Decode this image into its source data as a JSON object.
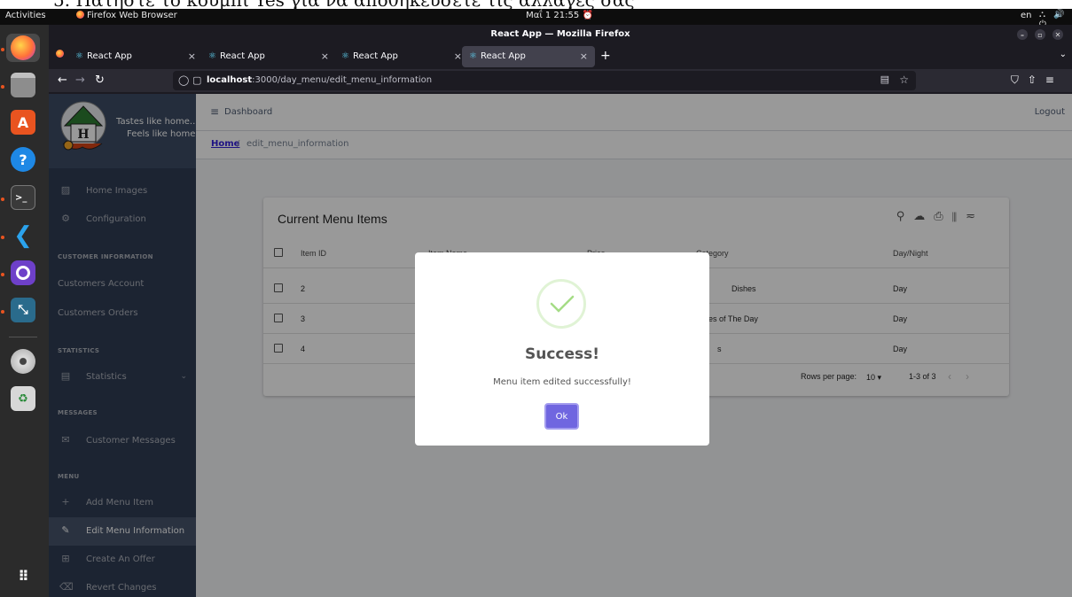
{
  "os": {
    "activities": "Activities",
    "app_name": "Firefox Web Browser",
    "clock": "Μαΐ 1 21:55",
    "lang": "en",
    "system_icons": "⛬ 🔊 ⏻"
  },
  "window": {
    "title": "React App — Mozilla Firefox"
  },
  "tabs": [
    {
      "label": "React App",
      "active": false
    },
    {
      "label": "React App",
      "active": false
    },
    {
      "label": "React App",
      "active": false
    },
    {
      "label": "React App",
      "active": true
    }
  ],
  "address": {
    "host": "localhost",
    "path": ":3000/day_menu/edit_menu_information"
  },
  "brand": {
    "tagline_1": "Tastes like home...",
    "tagline_2": "Feels like home"
  },
  "sidebar": {
    "items": [
      {
        "label": "Home Images",
        "icon": "image-icon"
      },
      {
        "label": "Configuration",
        "icon": "gear-icon"
      }
    ],
    "sections": [
      {
        "title": "CUSTOMER INFORMATION",
        "items": [
          "Customers Account",
          "Customers Orders"
        ]
      },
      {
        "title": "STATISTICS",
        "items": [
          "Statistics"
        ]
      },
      {
        "title": "MESSAGES",
        "items": [
          "Customer Messages"
        ]
      },
      {
        "title": "MENU",
        "items": [
          "Add Menu Item",
          "Edit Menu Information",
          "Create An Offer",
          "Revert Changes"
        ]
      }
    ]
  },
  "header": {
    "dashboard": "Dashboard",
    "logout": "Logout"
  },
  "breadcrumb": {
    "home": "Home",
    "separator": "/",
    "current": "edit_menu_information"
  },
  "table": {
    "title": "Current Menu Items",
    "columns": [
      "Item ID",
      "Item Name",
      "Price",
      "Category",
      "Day/Night"
    ],
    "rows": [
      {
        "id": "2",
        "name": "",
        "price": "",
        "category": "Dishes",
        "daynight": "Day"
      },
      {
        "id": "3",
        "name": "",
        "price": "",
        "category": "es of The Day",
        "daynight": "Day"
      },
      {
        "id": "4",
        "name": "",
        "price": "",
        "category": "s",
        "daynight": "Day"
      }
    ],
    "rows_per_page_label": "Rows per page:",
    "rows_per_page": "10",
    "range": "1-3 of 3"
  },
  "modal": {
    "title": "Success!",
    "message": "Menu item edited successfully!",
    "ok": "Ok"
  },
  "colors": {
    "accent": "#7066e0",
    "success": "#a5dc86",
    "sidebar": "#303c54",
    "link": "#321fdb"
  }
}
